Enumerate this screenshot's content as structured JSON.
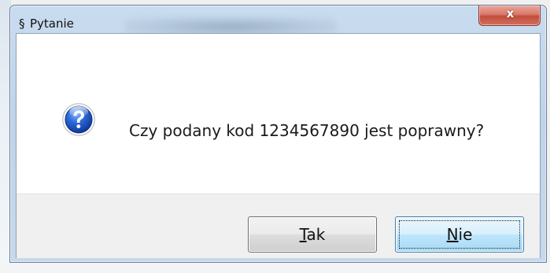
{
  "window": {
    "title": "Pytanie",
    "title_icon": "§",
    "close_label": "x"
  },
  "dialog": {
    "icon": "question-icon",
    "message": "Czy podany kod 1234567890 jest poprawny?"
  },
  "buttons": {
    "yes": {
      "accel": "T",
      "rest": "ak"
    },
    "no": {
      "accel": "N",
      "rest": "ie"
    }
  },
  "colors": {
    "titlebar": "#c4d8ec",
    "close_button": "#c74a3a",
    "focused_button": "#3c7fb1",
    "icon_blue": "#2159c3"
  }
}
